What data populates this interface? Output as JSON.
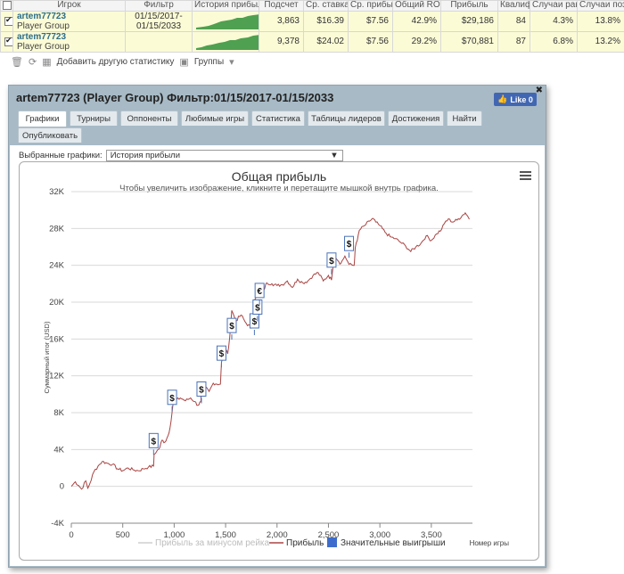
{
  "table": {
    "headers": [
      "Игрок",
      "Фильтр",
      "История прибыл",
      "Подсчет",
      "Ср. ставка",
      "Ср. прибы",
      "Общий ROI",
      "Прибыль",
      "Квалиф",
      "Случаи ранн",
      "Случаи позд"
    ],
    "rows": [
      {
        "name": "artem77723",
        "group": "Player Group",
        "filter": "01/15/2017-01/15/2033",
        "count": "3,863",
        "avg_stake": "$16.39",
        "avg_profit": "$7.56",
        "roi": "42.9%",
        "profit": "$29,186",
        "itm": "84",
        "early": "4.3%",
        "late": "13.8%"
      },
      {
        "name": "artem77723",
        "group": "Player Group",
        "filter": "",
        "count": "9,378",
        "avg_stake": "$24.02",
        "avg_profit": "$7.56",
        "roi": "29.2%",
        "profit": "$70,881",
        "itm": "87",
        "early": "6.8%",
        "late": "13.2%"
      }
    ]
  },
  "toolbar": {
    "add_stat": "Добавить другую статистику",
    "groups": "Группы"
  },
  "panel": {
    "title": "artem77723 (Player Group) Фильтр:01/15/2017-01/15/2033",
    "fb_like": "Like 0",
    "tabs": [
      "Графики",
      "Турниры",
      "Оппоненты",
      "Любимые игры",
      "Статистика",
      "Таблицы лидеров",
      "Достижения",
      "Найти",
      "Опубликовать"
    ],
    "select_label": "Выбранные графики:",
    "select_value": "История прибыли"
  },
  "colors": {
    "panel_bg": "#a7bac6",
    "profit_line": "#a94442",
    "marker_border": "#4a72b8",
    "legend_bonus": "#3d6dcc"
  },
  "chart_data": {
    "type": "line",
    "title": "Общая прибыль",
    "subtitle": "Чтобы увеличить изображение, кликните и перетащите мышкой внутрь графика.",
    "ylabel": "Суммарный итог (USD)",
    "xlabel": "Номер игры",
    "ylim": [
      -4000,
      32000
    ],
    "xlim": [
      0,
      3900
    ],
    "y_ticks": [
      "-4K",
      "0",
      "4K",
      "8K",
      "12K",
      "16K",
      "20K",
      "24K",
      "28K",
      "32K"
    ],
    "x_ticks": [
      "0",
      "500",
      "1,000",
      "1,500",
      "2,000",
      "2,500",
      "3,000",
      "3,500"
    ],
    "series": [
      {
        "name": "Прибыль за минусом рейка",
        "values": []
      },
      {
        "name": "Прибыль",
        "x": [
          0,
          40,
          70,
          100,
          140,
          160,
          180,
          220,
          260,
          300,
          350,
          400,
          450,
          500,
          550,
          600,
          650,
          700,
          750,
          800,
          805,
          830,
          860,
          880,
          910,
          940,
          960,
          980,
          1000,
          1010,
          1060,
          1110,
          1160,
          1200,
          1230,
          1260,
          1265,
          1300,
          1340,
          1380,
          1450,
          1460,
          1500,
          1520,
          1540,
          1560,
          1600,
          1650,
          1700,
          1750,
          1770,
          1780,
          1785,
          1810,
          1830,
          1870,
          1900,
          1950,
          2000,
          2050,
          2100,
          2150,
          2200,
          2250,
          2300,
          2350,
          2400,
          2450,
          2500,
          2530,
          2550,
          2560,
          2600,
          2620,
          2660,
          2700,
          2750,
          2760,
          2780,
          2800,
          2850,
          2900,
          2930,
          2960,
          3000,
          3050,
          3100,
          3150,
          3200,
          3250,
          3300,
          3350,
          3400,
          3450,
          3500,
          3550,
          3600,
          3640,
          3680,
          3700,
          3750,
          3800,
          3830,
          3850,
          3870
        ],
        "values": [
          0,
          500,
          100,
          -300,
          600,
          -200,
          300,
          1600,
          2200,
          2700,
          2500,
          2400,
          1900,
          1700,
          2000,
          1800,
          1700,
          1900,
          2100,
          2200,
          3500,
          3800,
          4200,
          5000,
          4800,
          5500,
          6400,
          8100,
          10000,
          9300,
          9600,
          9300,
          9600,
          9200,
          8800,
          9200,
          11000,
          10800,
          10300,
          11200,
          11100,
          13500,
          14800,
          14400,
          16200,
          19100,
          18000,
          18600,
          17700,
          17200,
          17800,
          19300,
          20300,
          20600,
          21700,
          21300,
          22100,
          22000,
          21800,
          21900,
          22300,
          21600,
          22500,
          22100,
          22300,
          22900,
          23200,
          22300,
          22900,
          22400,
          24700,
          25100,
          24400,
          24200,
          25000,
          24100,
          24000,
          25900,
          26700,
          27800,
          28300,
          28800,
          29100,
          28700,
          28300,
          27600,
          27100,
          26900,
          26500,
          26100,
          25500,
          26000,
          26400,
          27200,
          26700,
          27400,
          27900,
          28800,
          29000,
          28700,
          28900,
          29400,
          29700,
          29400,
          29000
        ]
      },
      {
        "name": "Значительные выигрыши",
        "values": []
      }
    ],
    "big_wins": [
      {
        "x": 800,
        "y": 4000,
        "symbol": "$"
      },
      {
        "x": 980,
        "y": 8700,
        "symbol": "$"
      },
      {
        "x": 1265,
        "y": 9600,
        "symbol": "$"
      },
      {
        "x": 1460,
        "y": 13500,
        "symbol": "$"
      },
      {
        "x": 1560,
        "y": 16500,
        "symbol": "$"
      },
      {
        "x": 1780,
        "y": 17000,
        "symbol": "$"
      },
      {
        "x": 1810,
        "y": 18500,
        "symbol": "$"
      },
      {
        "x": 1830,
        "y": 20300,
        "symbol": "€"
      },
      {
        "x": 2530,
        "y": 23600,
        "symbol": "$"
      },
      {
        "x": 2700,
        "y": 25400,
        "symbol": "$"
      }
    ],
    "legend": [
      "Прибыль за минусом рейка",
      "Прибыль",
      "Значительные выигрыши"
    ],
    "grid": true
  }
}
